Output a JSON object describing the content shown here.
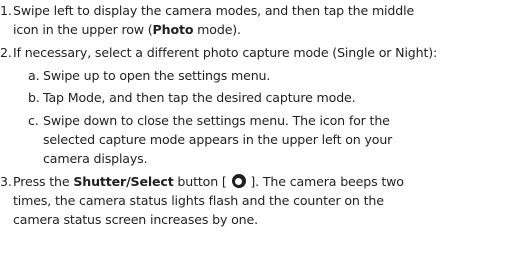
{
  "steps": [
    {
      "number": "1.",
      "lines": {
        "l1": "Swipe left to display the camera modes, and then tap the middle",
        "l2_pre": "icon in the upper row (",
        "l2_bold": "Photo",
        "l2_post": " mode)."
      }
    },
    {
      "number": "2.",
      "lines": {
        "l1": "If necessary, select a different photo capture mode (Single or Night):"
      },
      "substeps": [
        {
          "letter": "a.",
          "lines": {
            "l1": "Swipe up to open the settings menu."
          }
        },
        {
          "letter": "b.",
          "lines": {
            "l1": "Tap Mode, and then tap the desired capture mode."
          }
        },
        {
          "letter": "c.",
          "lines": {
            "l1": "Swipe down to close the settings menu. The icon for the",
            "l2": "selected capture mode appears in the upper left on your",
            "l3": "camera displays."
          }
        }
      ]
    },
    {
      "number": "3.",
      "lines": {
        "l1_pre": "Press the ",
        "l1_bold": "Shutter/Select",
        "l1_mid": " button [ ",
        "l1_post": " ]. The camera beeps two",
        "l2": "times, the camera status lights flash and the counter on the",
        "l3": "camera status screen increases by one."
      },
      "icon": "shutter-button-icon"
    }
  ]
}
